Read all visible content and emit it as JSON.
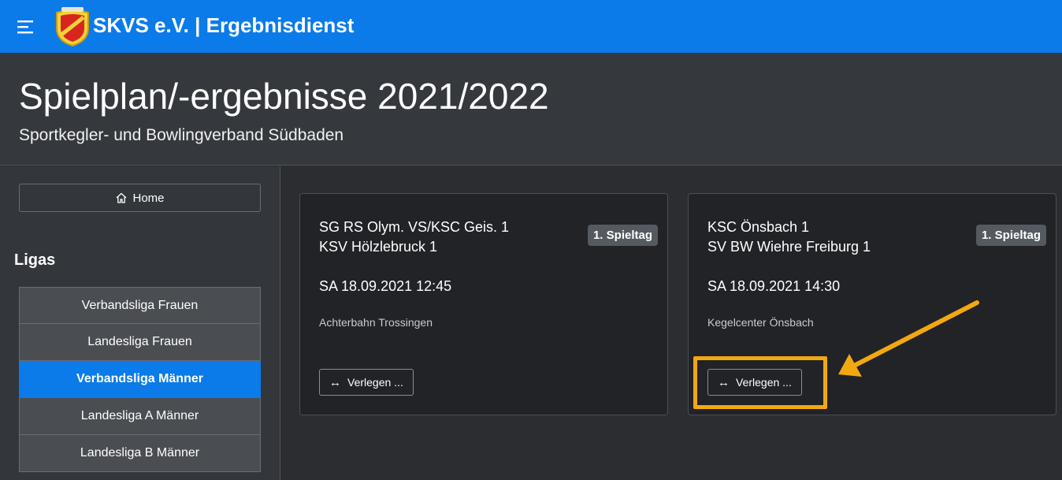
{
  "header": {
    "app_title": "SKVS e.V. | Ergebnisdienst",
    "menu_icon": "hamburger-menu-icon",
    "logo": "skvs-crest-logo",
    "accent_color": "#0b7bea"
  },
  "hero": {
    "title": "Spielplan/-ergebnisse 2021/2022",
    "subtitle": "Sportkegler- und Bowlingverband Südbaden"
  },
  "sidebar": {
    "home_label": "Home",
    "home_icon": "home-icon",
    "section_heading": "Ligas",
    "leagues": [
      {
        "label": "Verbandsliga Frauen",
        "active": false
      },
      {
        "label": "Landesliga Frauen",
        "active": false
      },
      {
        "label": "Verbandsliga Männer",
        "active": true
      },
      {
        "label": "Landesliga A Männer",
        "active": false
      },
      {
        "label": "Landesliga B Männer",
        "active": false
      }
    ]
  },
  "matches": [
    {
      "home_team": "SG RS Olym. VS/KSC Geis. 1",
      "away_team": "KSV Hölzlebruck 1",
      "matchday": "1. Spieltag",
      "datetime": "SA 18.09.2021 12:45",
      "venue": "Achterbahn Trossingen",
      "move_label": "Verlegen ..."
    },
    {
      "home_team": "KSC Önsbach 1",
      "away_team": "SV BW Wiehre Freiburg 1",
      "matchday": "1. Spieltag",
      "datetime": "SA 18.09.2021 14:30",
      "venue": "Kegelcenter Önsbach",
      "move_label": "Verlegen ..."
    }
  ],
  "annotation": {
    "highlight_color": "#f2a80f"
  }
}
